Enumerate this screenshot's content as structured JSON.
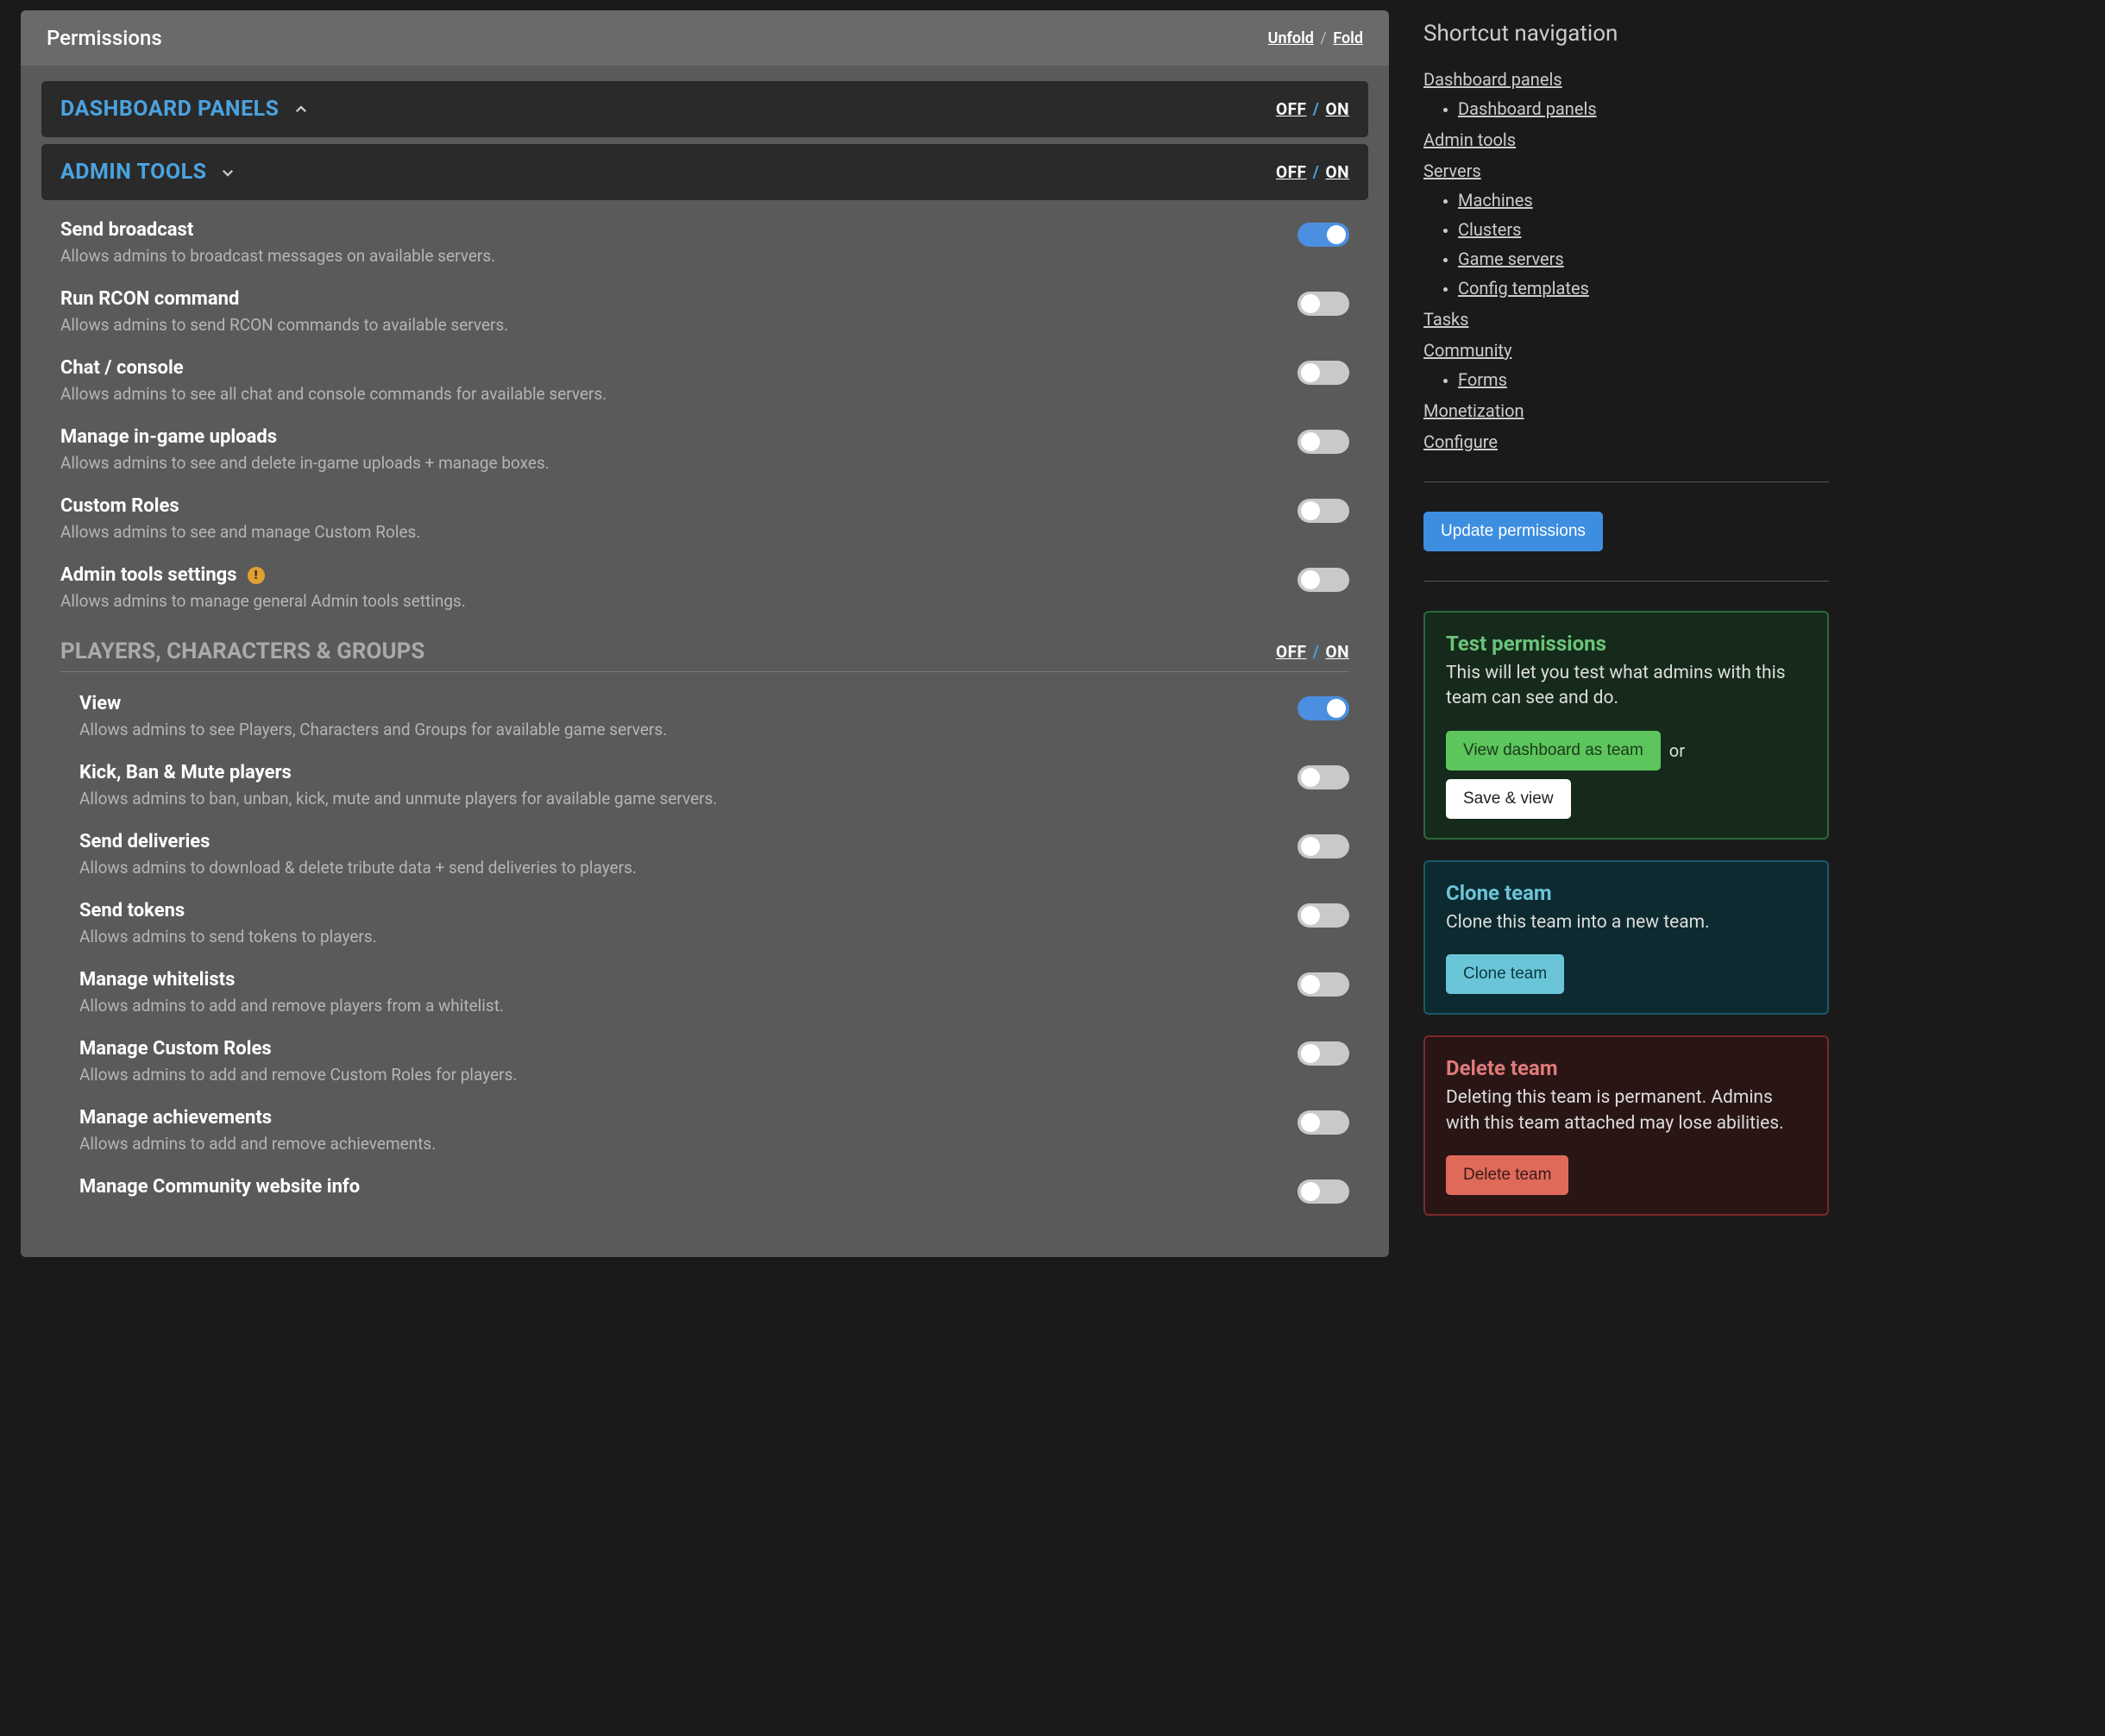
{
  "panel": {
    "title": "Permissions",
    "unfold": "Unfold",
    "fold": "Fold"
  },
  "offon": {
    "off": "OFF",
    "on": "ON"
  },
  "sections": {
    "dashboard": {
      "title": "DASHBOARD PANELS",
      "collapsed": true
    },
    "admin": {
      "title": "ADMIN TOOLS",
      "collapsed": false,
      "items": [
        {
          "title": "Send broadcast",
          "desc": "Allows admins to broadcast messages on available servers.",
          "on": true
        },
        {
          "title": "Run RCON command",
          "desc": "Allows admins to send RCON commands to available servers.",
          "on": false
        },
        {
          "title": "Chat / console",
          "desc": "Allows admins to see all chat and console commands for available servers.",
          "on": false
        },
        {
          "title": "Manage in-game uploads",
          "desc": "Allows admins to see and delete in-game uploads + manage boxes.",
          "on": false
        },
        {
          "title": "Custom Roles",
          "desc": "Allows admins to see and manage Custom Roles.",
          "on": false
        },
        {
          "title": "Admin tools settings",
          "desc": "Allows admins to manage general Admin tools settings.",
          "on": false,
          "warn": true
        }
      ]
    },
    "players": {
      "title": "PLAYERS, CHARACTERS & GROUPS",
      "items": [
        {
          "title": "View",
          "desc": "Allows admins to see Players, Characters and Groups for available game servers.",
          "on": true
        },
        {
          "title": "Kick, Ban & Mute players",
          "desc": "Allows admins to ban, unban, kick, mute and unmute players for available game servers.",
          "on": false
        },
        {
          "title": "Send deliveries",
          "desc": "Allows admins to download & delete tribute data + send deliveries to players.",
          "on": false
        },
        {
          "title": "Send tokens",
          "desc": "Allows admins to send tokens to players.",
          "on": false
        },
        {
          "title": "Manage whitelists",
          "desc": "Allows admins to add and remove players from a whitelist.",
          "on": false
        },
        {
          "title": "Manage Custom Roles",
          "desc": "Allows admins to add and remove Custom Roles for players.",
          "on": false
        },
        {
          "title": "Manage achievements",
          "desc": "Allows admins to add and remove achievements.",
          "on": false
        },
        {
          "title": "Manage Community website info",
          "desc": "",
          "on": false
        }
      ]
    }
  },
  "sidebar": {
    "title": "Shortcut navigation",
    "nav": {
      "dashboard_panels": "Dashboard panels",
      "dashboard_panels_sub": [
        "Dashboard panels"
      ],
      "admin_tools": "Admin tools",
      "servers": "Servers",
      "servers_sub": [
        "Machines",
        "Clusters",
        "Game servers",
        "Config templates"
      ],
      "tasks": "Tasks",
      "community": "Community",
      "community_sub": [
        "Forms"
      ],
      "monetization": "Monetization",
      "configure": "Configure"
    },
    "update_btn": "Update permissions",
    "cards": {
      "test": {
        "title": "Test permissions",
        "body": "This will let you test what admins with this team can see and do.",
        "primary": "View dashboard as team",
        "or": "or",
        "secondary": "Save & view"
      },
      "clone": {
        "title": "Clone team",
        "body": "Clone this team into a new team.",
        "primary": "Clone team"
      },
      "delete": {
        "title": "Delete team",
        "body": "Deleting this team is permanent. Admins with this team attached may lose abilities.",
        "primary": "Delete team"
      }
    }
  }
}
